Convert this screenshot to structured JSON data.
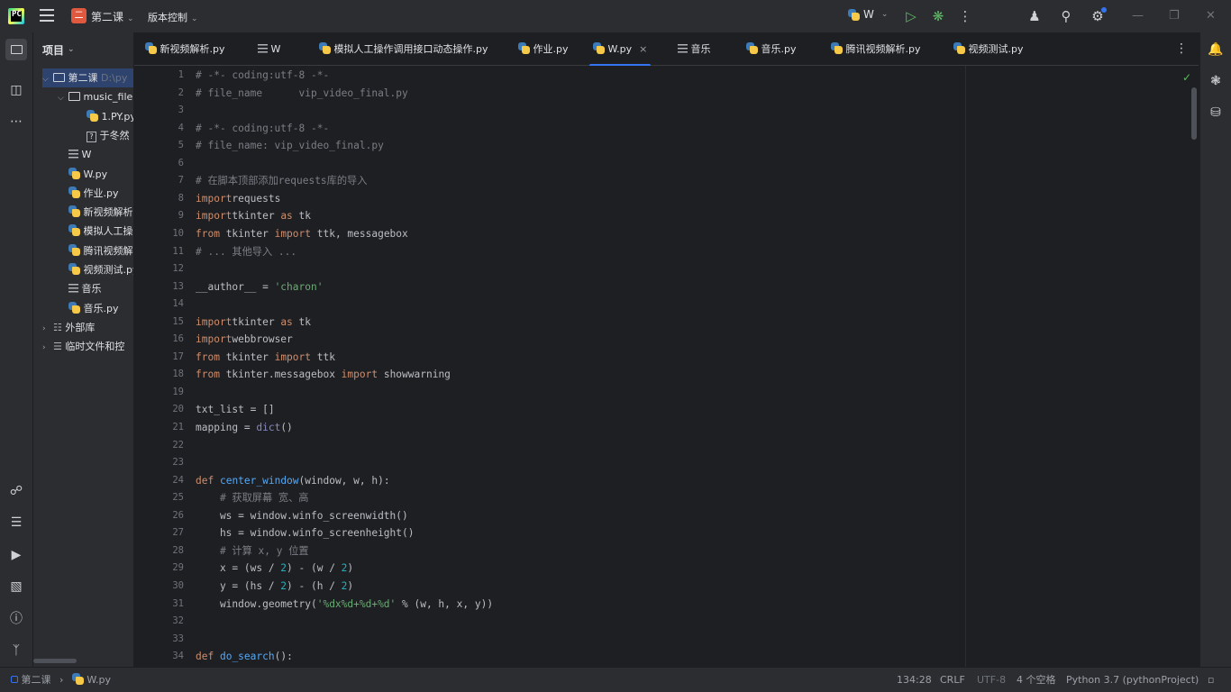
{
  "titlebar": {
    "project_badge": "二",
    "project_name": "第二课",
    "vcs_label": "版本控制",
    "run_config": "W"
  },
  "project_panel": {
    "title": "项目",
    "tree": [
      {
        "label": "第二课",
        "extra": "D:\\py",
        "icon": "folder-icon",
        "arrow": "⌵",
        "level": 0
      },
      {
        "label": "music_file",
        "icon": "folder-icon",
        "arrow": "⌵",
        "level": 1
      },
      {
        "label": "1.PY.py",
        "icon": "python-file-icon",
        "arrow": "",
        "level": 2
      },
      {
        "label": "于冬然",
        "icon": "unknown-file-icon",
        "arrow": "",
        "level": 2
      },
      {
        "label": "W",
        "icon": "text-file-icon",
        "arrow": "",
        "level": 1
      },
      {
        "label": "W.py",
        "icon": "python-file-icon",
        "arrow": "",
        "level": 1
      },
      {
        "label": "作业.py",
        "icon": "python-file-icon",
        "arrow": "",
        "level": 1
      },
      {
        "label": "新视频解析",
        "icon": "python-file-icon",
        "arrow": "",
        "level": 1
      },
      {
        "label": "模拟人工操",
        "icon": "python-file-icon",
        "arrow": "",
        "level": 1
      },
      {
        "label": "腾讯视频解",
        "icon": "python-file-icon",
        "arrow": "",
        "level": 1
      },
      {
        "label": "视频测试.py",
        "icon": "python-file-icon",
        "arrow": "",
        "level": 1
      },
      {
        "label": "音乐",
        "icon": "text-file-icon",
        "arrow": "",
        "level": 1
      },
      {
        "label": "音乐.py",
        "icon": "python-file-icon",
        "arrow": "",
        "level": 1
      },
      {
        "label": "外部库",
        "icon": "library-icon",
        "arrow": "›",
        "level": 0
      },
      {
        "label": "临时文件和控",
        "icon": "scratches-icon",
        "arrow": "›",
        "level": 0
      }
    ]
  },
  "tabs": [
    {
      "label": "新视频解析.py",
      "icon": "python-file-icon"
    },
    {
      "label": "W",
      "icon": "text-file-icon"
    },
    {
      "label": "模拟人工操作调用接口动态操作.py",
      "icon": "python-file-icon"
    },
    {
      "label": "作业.py",
      "icon": "python-file-icon"
    },
    {
      "label": "W.py",
      "icon": "python-file-icon",
      "active": true,
      "close": "×"
    },
    {
      "label": "音乐",
      "icon": "text-file-icon"
    },
    {
      "label": "音乐.py",
      "icon": "python-file-icon"
    },
    {
      "label": "腾讯视频解析.py",
      "icon": "python-file-icon"
    },
    {
      "label": "视频测试.py",
      "icon": "python-file-icon"
    }
  ],
  "editor": {
    "line_numbers": [
      "1",
      "2",
      "3",
      "4",
      "5",
      "6",
      "7",
      "8",
      "9",
      "10",
      "11",
      "12",
      "13",
      "14",
      "15",
      "16",
      "17",
      "18",
      "19",
      "20",
      "21",
      "22",
      "23",
      "24",
      "25",
      "26",
      "27",
      "28",
      "29",
      "30",
      "31",
      "32",
      "33",
      "34"
    ],
    "lines": [
      [
        [
          "c-com",
          "# -*- coding:utf-8 -*-"
        ]
      ],
      [
        [
          "c-com",
          "# file_name      vip_video_final.py"
        ]
      ],
      [],
      [
        [
          "c-com",
          "# -*- coding:utf-8 -*-"
        ]
      ],
      [
        [
          "c-com",
          "# file_name: vip_video_final.py"
        ]
      ],
      [],
      [
        [
          "c-com",
          "# 在脚本顶部添加requests库的导入"
        ]
      ],
      [
        [
          "c-kw",
          "import"
        ],
        [
          "",
          "requests"
        ]
      ],
      [
        [
          "c-kw",
          "import"
        ],
        [
          "",
          "tkinter "
        ],
        [
          "c-kw",
          "as"
        ],
        [
          "",
          " tk"
        ]
      ],
      [
        [
          "c-kw",
          "from"
        ],
        [
          "",
          " tkinter "
        ],
        [
          "c-kw",
          "import"
        ],
        [
          "",
          " ttk, messagebox"
        ]
      ],
      [
        [
          "c-com",
          "# ... 其他导入 ..."
        ]
      ],
      [],
      [
        [
          "",
          "__author__ = "
        ],
        [
          "c-str",
          "'charon'"
        ]
      ],
      [],
      [
        [
          "c-kw",
          "import"
        ],
        [
          "",
          "tkinter "
        ],
        [
          "c-kw",
          "as"
        ],
        [
          "",
          " tk"
        ]
      ],
      [
        [
          "c-kw",
          "import"
        ],
        [
          "",
          "webbrowser"
        ]
      ],
      [
        [
          "c-kw",
          "from"
        ],
        [
          "",
          " tkinter "
        ],
        [
          "c-kw",
          "import"
        ],
        [
          "",
          " ttk"
        ]
      ],
      [
        [
          "c-kw",
          "from"
        ],
        [
          "",
          " tkinter.messagebox "
        ],
        [
          "c-kw",
          "import"
        ],
        [
          "",
          " showwarning"
        ]
      ],
      [],
      [
        [
          "",
          "txt_list = []"
        ]
      ],
      [
        [
          "",
          "mapping = "
        ],
        [
          "c-bi",
          "dict"
        ],
        [
          "",
          "()"
        ]
      ],
      [],
      [],
      [
        [
          "c-kw",
          "def"
        ],
        [
          "",
          " "
        ],
        [
          "c-fn",
          "center_window"
        ],
        [
          "",
          "(window, w, h):"
        ]
      ],
      [
        [
          "",
          "    "
        ],
        [
          "c-com",
          "# 获取屏幕 宽、高"
        ]
      ],
      [
        [
          "",
          "    ws = window.winfo_screenwidth()"
        ]
      ],
      [
        [
          "",
          "    hs = window.winfo_screenheight()"
        ]
      ],
      [
        [
          "",
          "    "
        ],
        [
          "c-com",
          "# 计算 x, y 位置"
        ]
      ],
      [
        [
          "",
          "    x = (ws / "
        ],
        [
          "c-num",
          "2"
        ],
        [
          "",
          ") - (w / "
        ],
        [
          "c-num",
          "2"
        ],
        [
          "",
          ")"
        ]
      ],
      [
        [
          "",
          "    y = (hs / "
        ],
        [
          "c-num",
          "2"
        ],
        [
          "",
          ") - (h / "
        ],
        [
          "c-num",
          "2"
        ],
        [
          "",
          ")"
        ]
      ],
      [
        [
          "",
          "    window.geometry("
        ],
        [
          "c-str",
          "'%dx%d+%d+%d'"
        ],
        [
          "",
          " % (w, h, x, y))"
        ]
      ],
      [],
      [],
      [
        [
          "c-kw",
          "def"
        ],
        [
          "",
          " "
        ],
        [
          "c-fn",
          "do_search"
        ],
        [
          "",
          "():"
        ]
      ]
    ]
  },
  "statusbar": {
    "breadcrumb_project": "第二课",
    "breadcrumb_sep": "›",
    "breadcrumb_file": "W.py",
    "position": "134:28",
    "line_sep": "CRLF",
    "encoding": "UTF-8",
    "indent": "4 个空格",
    "interpreter": "Python 3.7 (pythonProject)"
  },
  "colors": {
    "accent": "#3574f0",
    "keyword": "#cf8e6d",
    "string": "#6aab73",
    "comment": "#7a7e85",
    "number": "#2aacb8",
    "function": "#56a8f5"
  }
}
